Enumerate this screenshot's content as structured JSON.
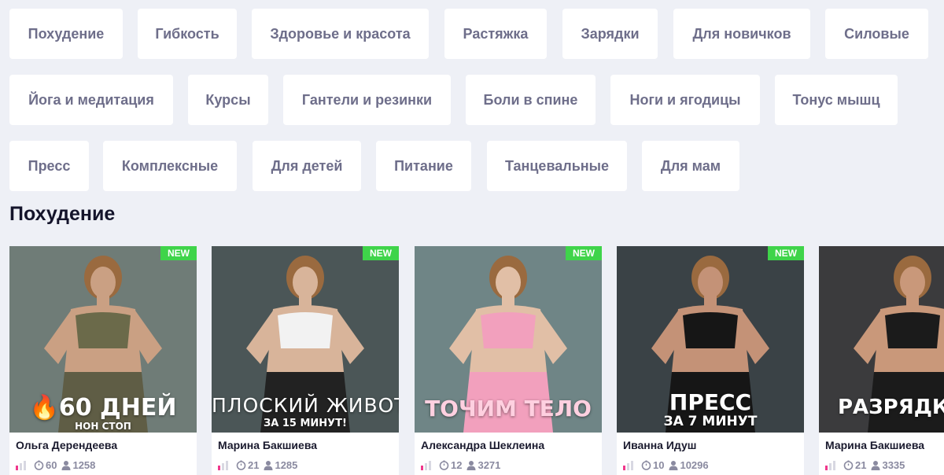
{
  "categories": [
    [
      "Похудение",
      "Гибкость",
      "Здоровье и красота",
      "Растяжка",
      "Зарядки",
      "Для новичков",
      "Силовые"
    ],
    [
      "Йога и медитация",
      "Курсы",
      "Гантели и резинки",
      "Боли в спине",
      "Ноги и ягодицы",
      "Тонус мышц"
    ],
    [
      "Пресс",
      "Комплексные",
      "Для детей",
      "Питание",
      "Танцевальные",
      "Для мам"
    ]
  ],
  "section": {
    "title": "Похудение"
  },
  "colors": {
    "accent_new": "#3fd44a",
    "level_on": "#f0388c",
    "chip_text": "#6e6e8a",
    "background": "#eef0f6"
  },
  "cards": [
    {
      "badge": "NEW",
      "cover_line1": "🔥60 ДНЕЙ",
      "cover_line2": "НОН СТОП",
      "author": "Ольга Дерендеева",
      "level": 1,
      "workouts": "60",
      "users": "1258",
      "bg": "#6f7c77"
    },
    {
      "badge": "NEW",
      "cover_line1": "ПЛОСКИЙ ЖИВОТ",
      "cover_line2": "ЗА 15 МИНУТ!",
      "author": "Марина Бакшиева",
      "level": 1,
      "workouts": "21",
      "users": "1285",
      "bg": "#4b5657"
    },
    {
      "badge": "NEW",
      "cover_line1": "ТОЧИМ ТЕЛО",
      "cover_line2": "",
      "author": "Александра Шеклеина",
      "level": 1,
      "workouts": "12",
      "users": "3271",
      "bg": "#6f8586"
    },
    {
      "badge": "NEW",
      "cover_line1": "ПРЕСС",
      "cover_line2": "ЗА 7 МИНУТ",
      "author": "Иванна Идуш",
      "level": 1,
      "workouts": "10",
      "users": "10296",
      "bg": "#3a4246"
    },
    {
      "badge": "",
      "cover_line1": "РАЗРЯДК",
      "cover_line2": "",
      "author": "Марина Бакшиева",
      "level": 1,
      "workouts": "21",
      "users": "3335",
      "bg": "#3b3b3d"
    }
  ]
}
